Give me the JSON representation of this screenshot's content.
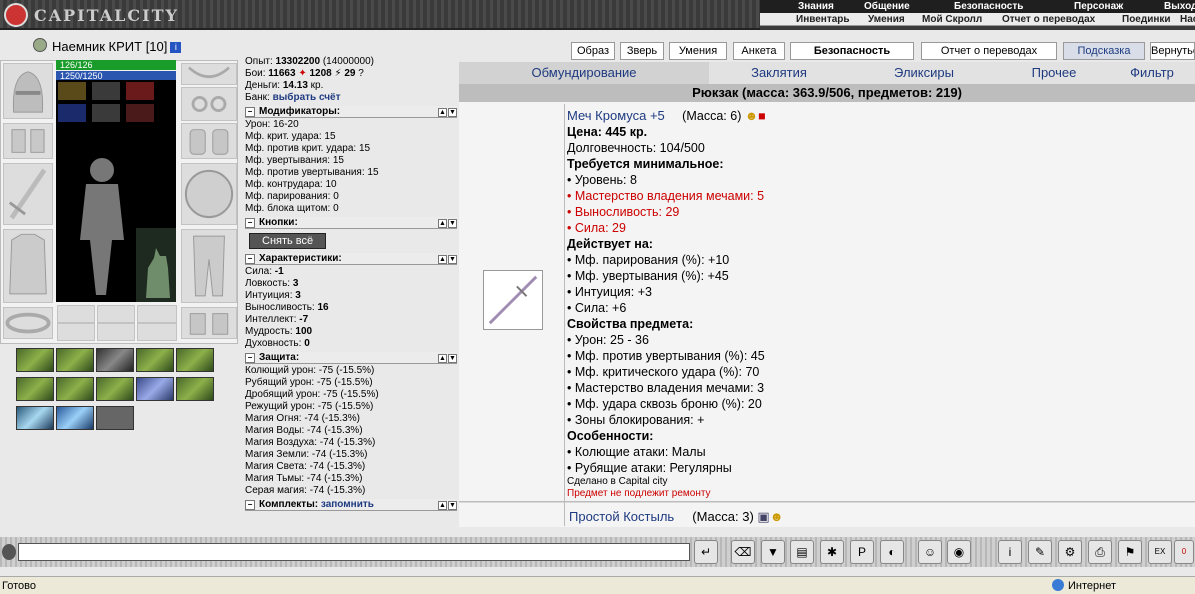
{
  "logo_text": "CAPITALCITY",
  "menu_top": [
    "Знания",
    "Общение",
    "Безопасность",
    "Персонаж",
    "Выход"
  ],
  "menu_sub": [
    "Инвентарь",
    "Умения",
    "Мой Скролл",
    "Отчет о переводах",
    "Поединки",
    "Настр"
  ],
  "character": {
    "name": "Наемник КРИТ",
    "level": "[10]",
    "hp": "126/126",
    "mana": "1250/1250",
    "hp_fraction": 1.0,
    "mana_fraction": 1.0
  },
  "nav_buttons": [
    "Образ",
    "Зверь",
    "Умения",
    "Анкета",
    "Безопасность",
    "Отчет о переводах",
    "Подсказка",
    "Вернуться"
  ],
  "stats_top": [
    {
      "label": "Опыт:",
      "value": "13302200",
      "extra": "(14000000)"
    },
    {
      "label": "Бои:",
      "value": "11663",
      "extra": "1208",
      "extra2": "29"
    },
    {
      "label": "Деньги:",
      "value": "14.13",
      "extra": "кр."
    },
    {
      "label": "Банк:",
      "value": "выбрать счёт"
    }
  ],
  "sections": {
    "modifiers": "Модификаторы:",
    "buttons": "Кнопки:",
    "characteristics": "Характеристики:",
    "protection": "Защита:",
    "sets": "Комплекты:",
    "sets_remember": "запомнить"
  },
  "modifiers": [
    "Урон: 16-20",
    "Мф. крит. удара: 15",
    "Мф. против крит. удара: 15",
    "Мф. увертывания: 15",
    "Мф. против увертывания: 15",
    "Мф. контрудара: 10",
    "Мф. парирования: 0",
    "Мф. блока щитом: 0"
  ],
  "unequip_all": "Снять всё",
  "characteristics": [
    {
      "label": "Сила:",
      "value": "-1"
    },
    {
      "label": "Ловкость:",
      "value": "3"
    },
    {
      "label": "Интуиция:",
      "value": "3"
    },
    {
      "label": "Выносливость:",
      "value": "16"
    },
    {
      "label": "Интеллект:",
      "value": "-7"
    },
    {
      "label": "Мудрость:",
      "value": "100"
    },
    {
      "label": "Духовность:",
      "value": "0"
    }
  ],
  "protection": [
    "Колющий урон: -75 (-15.5%)",
    "Рубящий урон: -75 (-15.5%)",
    "Дробящий урон: -75 (-15.5%)",
    "Режущий урон: -75 (-15.5%)",
    "Магия Огня: -74 (-15.3%)",
    "Магия Воды: -74 (-15.3%)",
    "Магия Воздуха: -74 (-15.3%)",
    "Магия Земли: -74 (-15.3%)",
    "Магия Света: -74 (-15.3%)",
    "Магия Тьмы: -74 (-15.3%)",
    "Серая магия: -74 (-15.3%)"
  ],
  "tabs": [
    "Обмундирование",
    "Заклятия",
    "Эликсиры",
    "Прочее",
    "Фильтр"
  ],
  "backpack": "Рюкзак (масса: 363.9/506, предметов: 219)",
  "item1": {
    "name": "Меч Кромуса +5",
    "mass": "(Масса: 6)",
    "price": "Цена: 445 кр.",
    "durability": "Долговечность: 104/500",
    "req_title": "Требуется минимальное:",
    "requirements": [
      {
        "text": "Уровень: 8",
        "red": false
      },
      {
        "text": "Мастерство владения мечами: 5",
        "red": true
      },
      {
        "text": "Выносливость: 29",
        "red": true
      },
      {
        "text": "Сила: 29",
        "red": true
      }
    ],
    "acts_title": "Действует на:",
    "acts": [
      "Мф. парирования (%): +10",
      "Мф. увертывания (%): +45",
      "Интуиция: +3",
      "Сила: +6"
    ],
    "props_title": "Свойства предмета:",
    "props": [
      "Урон: 25 - 36",
      "Мф. против увертывания (%): 45",
      "Мф. критического удара (%): 70",
      "Мастерство владения мечами: 3",
      "Мф. удара сквозь броню (%): 20",
      "Зоны блокирования: +"
    ],
    "features_title": "Особенности:",
    "features": [
      "Колющие атаки: Малы",
      "Рубящие атаки: Регулярны"
    ],
    "made_in": "Сделано в Capital city",
    "no_repair": "Предмет не подлежит ремонту"
  },
  "item2": {
    "name": "Простой Костыль",
    "mass": "(Масса: 3)"
  },
  "status": {
    "left": "Готово",
    "zone": "Интернет"
  }
}
